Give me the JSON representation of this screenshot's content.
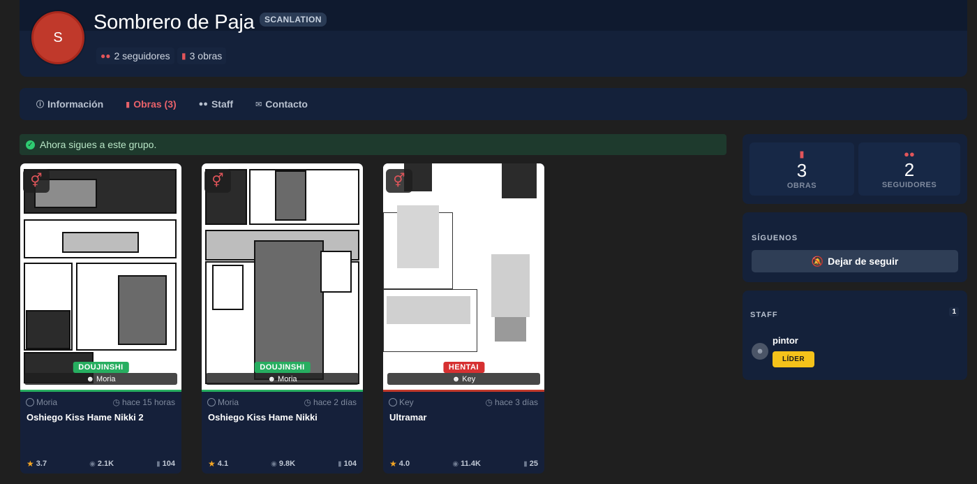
{
  "group": {
    "avatar_letter": "S",
    "name": "Sombrero de Paja",
    "type": "SCANLATION",
    "followers_text": "2 seguidores",
    "works_text": "3 obras"
  },
  "nav": {
    "items": [
      {
        "label": "Información",
        "icon": "info-icon"
      },
      {
        "label": "Obras (3)",
        "icon": "book-icon",
        "active": true
      },
      {
        "label": "Staff",
        "icon": "users-icon"
      },
      {
        "label": "Contacto",
        "icon": "envelope-icon"
      }
    ]
  },
  "alert": {
    "message": "Ahora sigues a este grupo."
  },
  "works": [
    {
      "category": "DOUJINSHI",
      "cover_author": "Moria",
      "author": "Moria",
      "time": "hace 15 horas",
      "title": "Oshiego Kiss Hame Nikki 2",
      "rating": "3.7",
      "views": "2.1K",
      "chapters": "104"
    },
    {
      "category": "DOUJINSHI",
      "cover_author": "Moria",
      "author": "Moria",
      "time": "hace 2 días",
      "title": "Oshiego Kiss Hame Nikki",
      "rating": "4.1",
      "views": "9.8K",
      "chapters": "104"
    },
    {
      "category": "HENTAI",
      "cover_author": "Key",
      "author": "Key",
      "time": "hace 3 días",
      "title": "Ultramar",
      "rating": "4.0",
      "views": "11.4K",
      "chapters": "25"
    }
  ],
  "sidebar": {
    "works_count": "3",
    "works_label": "OBRAS",
    "followers_count": "2",
    "followers_label": "SEGUIDORES",
    "follow_section": "SÍGUENOS",
    "unfollow_button": "Dejar de seguir",
    "staff_section": "STAFF",
    "staff_count": "1",
    "staff": [
      {
        "name": "pintor",
        "role": "LÍDER"
      }
    ]
  },
  "colors": {
    "accent_red": "#e8626a",
    "success_green": "#27ae60",
    "leader_yellow": "#f4c21a",
    "panel_bg": "#14213a"
  }
}
